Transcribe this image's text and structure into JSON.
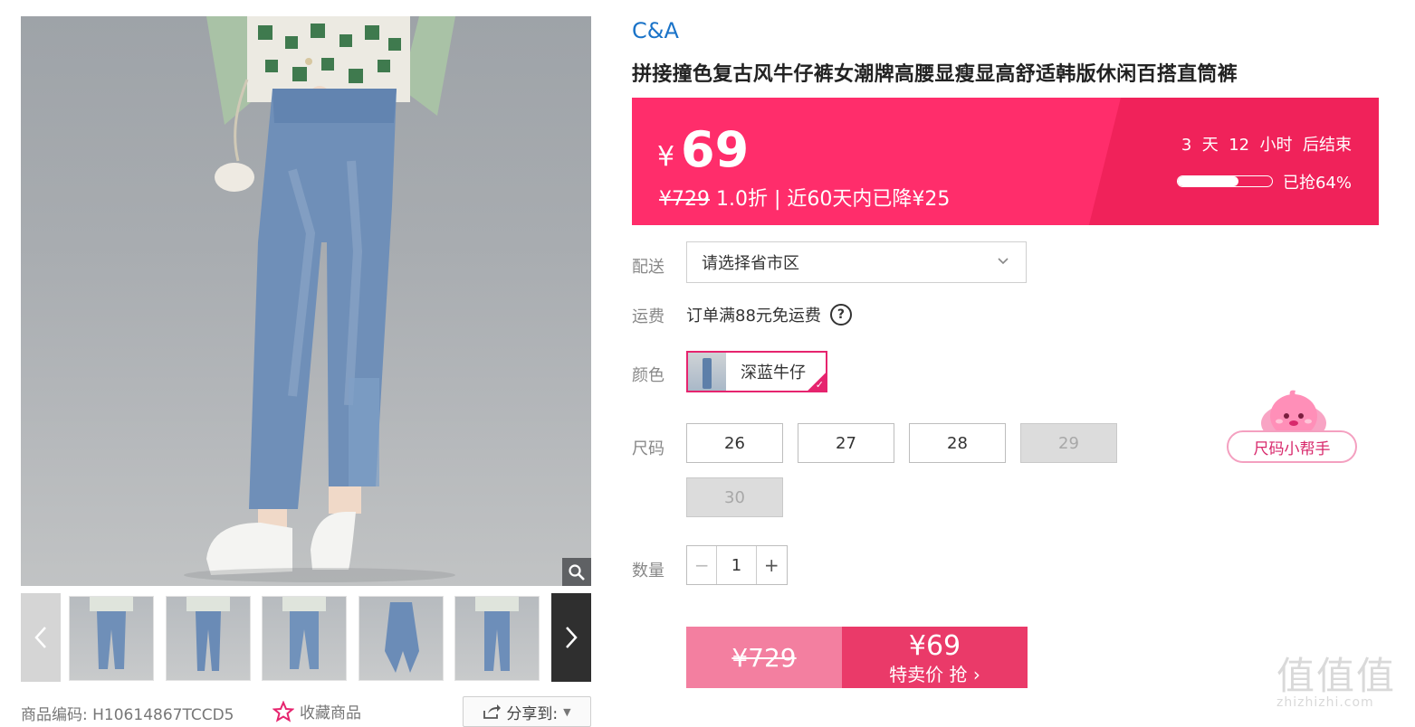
{
  "product": {
    "brand": "C&A",
    "title": "拼接撞色复古风牛仔裤女潮牌高腰显瘦显高舒适韩版休闲百搭直筒裤",
    "sku_label": "商品编码:",
    "sku": "H10614867TCCD5"
  },
  "price": {
    "currency": "¥",
    "sale": "69",
    "original": "¥729",
    "discount": "1.0折 | 近60天内已降¥25",
    "countdown": "3  天  12  小时  后结束",
    "sold_label": "已抢64%",
    "sold_fraction": 0.64
  },
  "options": {
    "delivery_label": "配送",
    "delivery_placeholder": "请选择省市区",
    "shipping_label": "运费",
    "shipping_text": "订单满88元免运费",
    "color_label": "颜色",
    "color_name": "深蓝牛仔",
    "size_label": "尺码",
    "sizes": [
      {
        "label": "26",
        "available": true
      },
      {
        "label": "27",
        "available": true
      },
      {
        "label": "28",
        "available": true
      },
      {
        "label": "29",
        "available": false
      },
      {
        "label": "30",
        "available": false
      }
    ],
    "qty_label": "数量",
    "qty_value": "1",
    "qty_minus": "−",
    "qty_plus": "+"
  },
  "size_helper": "尺码小帮手",
  "buy": {
    "original": "¥729",
    "price": "¥69",
    "label": "特卖价 抢 ›"
  },
  "actions": {
    "favorite": "收藏商品",
    "share": "分享到:"
  },
  "watermark": {
    "logo": "值值值",
    "site": "zhizhizhi.com"
  },
  "colors": {
    "accent": "#ff2d6b",
    "buy_button": "#ea3a69",
    "brand_link": "#1a73c8"
  }
}
